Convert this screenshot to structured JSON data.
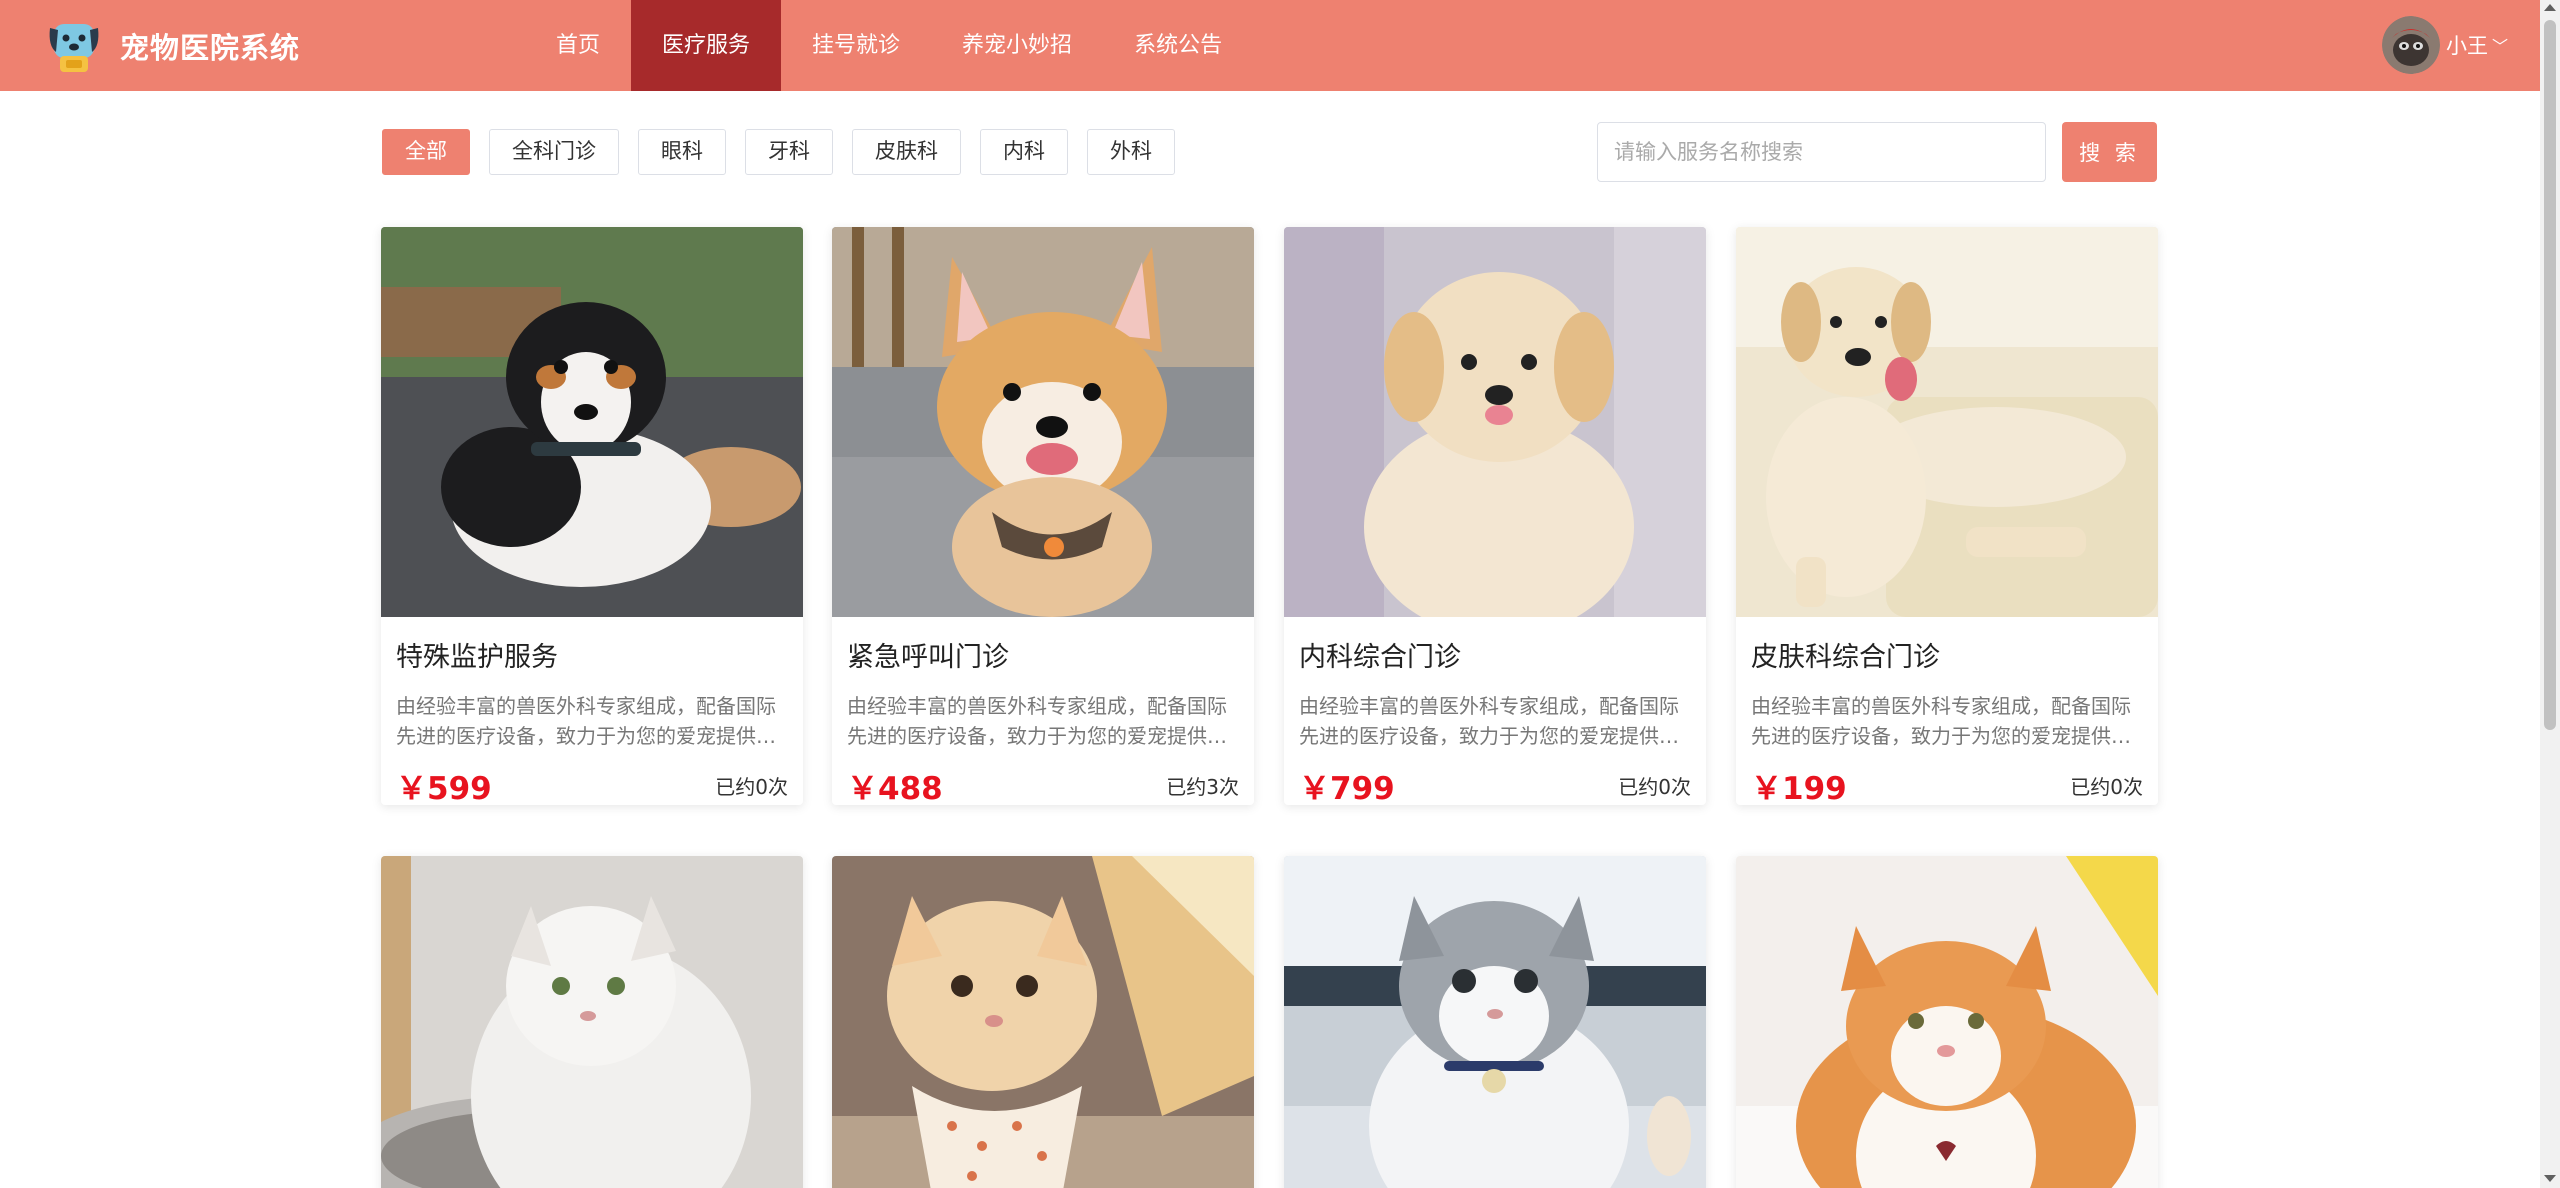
{
  "header": {
    "app_title": "宠物医院系统",
    "logo_icon": "dog-face-icon",
    "nav": [
      {
        "label": "首页",
        "active": false
      },
      {
        "label": "医疗服务",
        "active": true
      },
      {
        "label": "挂号就诊",
        "active": false
      },
      {
        "label": "养宠小妙招",
        "active": false
      },
      {
        "label": "系统公告",
        "active": false
      }
    ],
    "user": {
      "name": "小王",
      "dropdown_icon": "chevron-down-icon"
    }
  },
  "filters": {
    "items": [
      {
        "label": "全部",
        "active": true
      },
      {
        "label": "全科门诊",
        "active": false
      },
      {
        "label": "眼科",
        "active": false
      },
      {
        "label": "牙科",
        "active": false
      },
      {
        "label": "皮肤科",
        "active": false
      },
      {
        "label": "内科",
        "active": false
      },
      {
        "label": "外科",
        "active": false
      }
    ]
  },
  "search": {
    "placeholder": "请输入服务名称搜索",
    "value": "",
    "button_label": "搜 索"
  },
  "services": [
    {
      "title": "特殊监护服务",
      "desc": "由经验丰富的兽医外科专家组成，配备国际先进的医疗设备，致力于为您的爱宠提供专业服务",
      "price": "￥599",
      "booked": "已约0次",
      "image": "tricolor-dog-photo"
    },
    {
      "title": "紧急呼叫门诊",
      "desc": "由经验丰富的兽医外科专家组成，配备国际先进的医疗设备，致力于为您的爱宠提供专业服务",
      "price": "￥488",
      "booked": "已约3次",
      "image": "corgi-puppy-photo"
    },
    {
      "title": "内科综合门诊",
      "desc": "由经验丰富的兽医外科专家组成，配备国际先进的医疗设备，致力于为您的爱宠提供专业服务",
      "price": "￥799",
      "booked": "已约0次",
      "image": "golden-puppy-photo"
    },
    {
      "title": "皮肤科综合门诊",
      "desc": "由经验丰富的兽医外科专家组成，配备国际先进的医疗设备，致力于为您的爱宠提供专业服务",
      "price": "￥199",
      "booked": "已约0次",
      "image": "labrador-photo"
    },
    {
      "image": "white-persian-cat-photo"
    },
    {
      "image": "ginger-kitten-photo"
    },
    {
      "image": "grey-white-kitten-photo"
    },
    {
      "image": "orange-white-cat-photo"
    }
  ],
  "colors": {
    "brand": "#ee8170",
    "active_nav": "#a72a2b",
    "price": "#e8131f"
  }
}
